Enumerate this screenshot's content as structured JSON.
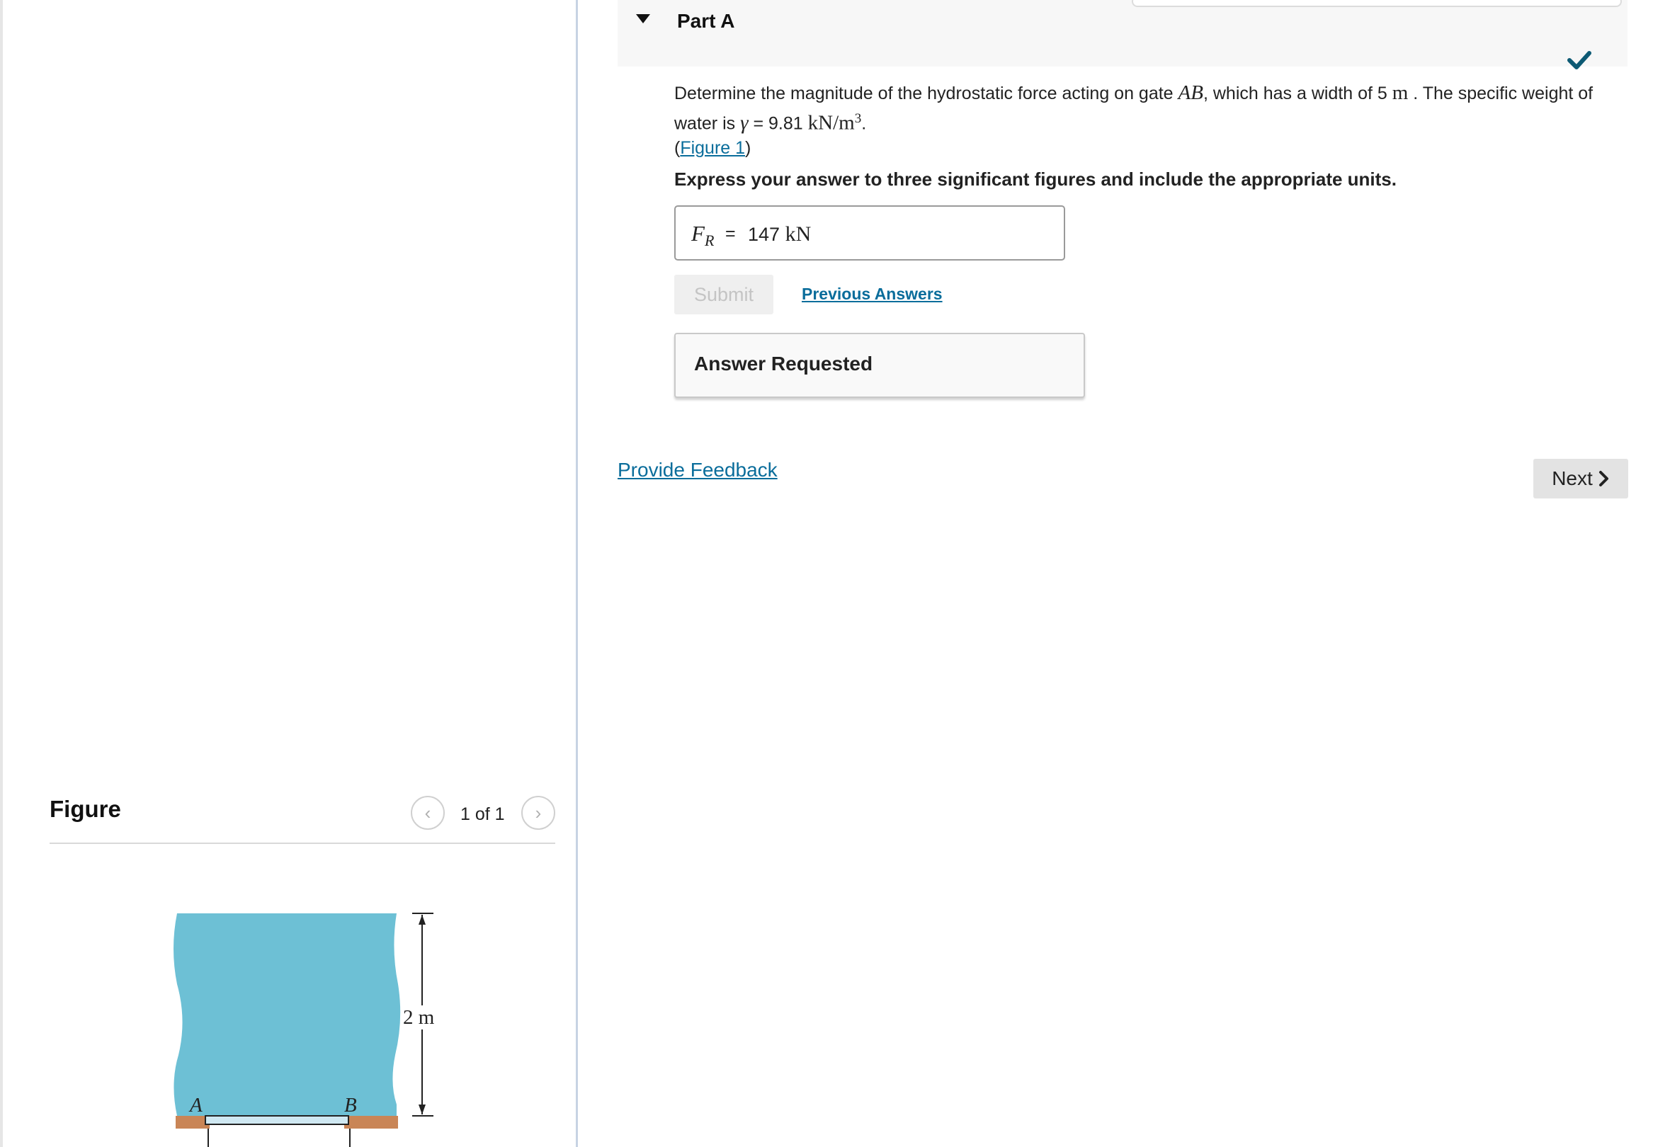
{
  "part": {
    "title": "Part A",
    "status_icon": "checkmark-icon"
  },
  "question": {
    "text_1": "Determine the magnitude of the hydrostatic force acting on gate ",
    "gate_label": "AB",
    "text_2": ", which has a width of 5 ",
    "width_unit": "m",
    "text_3": " . The specific weight of water is ",
    "gamma": "γ",
    "text_4": " = 9.81 ",
    "gamma_unit": "kN/m",
    "gamma_exp": "3",
    "text_5": ".",
    "figure_link": "Figure 1",
    "figure_open": "(",
    "figure_close": ")"
  },
  "instruction": "Express your answer to three significant figures and include the appropriate units.",
  "answer": {
    "var": "F",
    "var_sub": "R",
    "equals": "=",
    "value": "147",
    "unit": "kN"
  },
  "buttons": {
    "submit": "Submit",
    "previous_answers": "Previous Answers",
    "provide_feedback": "Provide Feedback",
    "next": "Next"
  },
  "feedback": {
    "status": "Answer Requested"
  },
  "figure": {
    "title": "Figure",
    "pager": "1 of 1",
    "labels": {
      "a": "A",
      "b": "B",
      "depth": "2 m"
    },
    "colors": {
      "water": "#6dc0d5",
      "gate": "#cfe8f2",
      "ground": "#c98556"
    }
  },
  "colors": {
    "link": "#0a6d9b",
    "check": "#0d5a74"
  }
}
